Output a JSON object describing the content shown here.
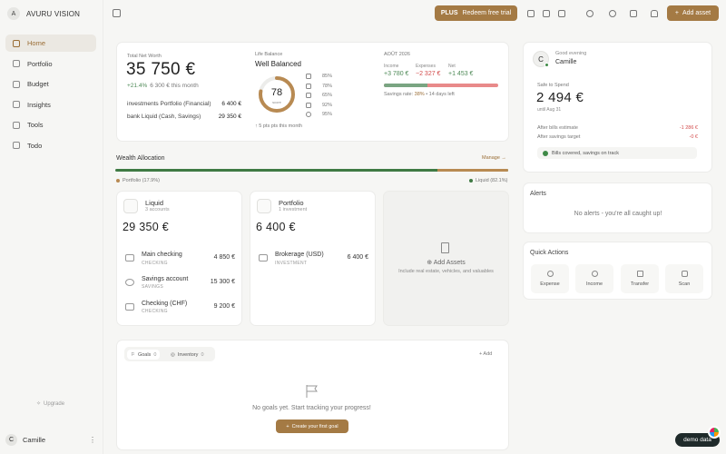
{
  "brand": {
    "avatar_letter": "A",
    "name": "AVURU VISION"
  },
  "nav": [
    {
      "label": "Home",
      "icon": "home-icon",
      "active": true
    },
    {
      "label": "Portfolio",
      "icon": "portfolio-icon"
    },
    {
      "label": "Budget",
      "icon": "budget-icon"
    },
    {
      "label": "Insights",
      "icon": "insights-icon"
    },
    {
      "label": "Tools",
      "icon": "tools-icon"
    },
    {
      "label": "Todo",
      "icon": "todo-icon"
    }
  ],
  "sidebar": {
    "upgrade": "Upgrade",
    "user_letter": "C",
    "user_name": "Camille",
    "menu_glyph": "⋮"
  },
  "topbar": {
    "plus_badge": "PLUS",
    "plus_label": "Redeem free trial",
    "add_asset": "Add asset",
    "add_glyph": "+"
  },
  "net_worth": {
    "label": "Total Net Worth",
    "value": "35 750 €",
    "change_pct": "+21.4%",
    "change_text": "6 300 € this month",
    "rows": [
      {
        "label": "investments  Portfolio (Financial)",
        "value": "6 400 €"
      },
      {
        "label": "bank  Liquid (Cash, Savings)",
        "value": "29 350 €"
      }
    ]
  },
  "life_balance": {
    "label": "Life Balance",
    "title": "Well Balanced",
    "score": 78,
    "score_label": "score",
    "metrics": [
      "85%",
      "78%",
      "65%",
      "92%",
      "95%"
    ],
    "footer": "↑ 5 pts pts this month"
  },
  "month": {
    "label": "AOÛT 2026",
    "income_label": "Income",
    "income": "+3 780 €",
    "expenses_label": "Expenses",
    "expenses": "−2 327 €",
    "net_label": "Net",
    "net": "+1 453 €",
    "savings_rate_fraction": 0.38,
    "savings_label": "Savings rate:",
    "savings_value": "38%",
    "days_left": "• 14 days left",
    "colors": {
      "income": "#4e8a57",
      "expense": "#d24a4a"
    }
  },
  "allocation": {
    "title": "Wealth Allocation",
    "manage": "Manage →",
    "portfolio_fraction": 0.179,
    "portfolio_label": "Portfolio (17.9%)",
    "liquid_label": "Liquid (82.1%)",
    "colors": {
      "portfolio": "#b88a52",
      "liquid": "#3f7a44"
    }
  },
  "liquid": {
    "title": "Liquid",
    "subtitle": "3 accounts",
    "total": "29 350 €",
    "accounts": [
      {
        "name": "Main checking",
        "type": "CHECKING",
        "value": "4 850 €"
      },
      {
        "name": "Savings account",
        "type": "SAVINGS",
        "value": "15 300 €"
      },
      {
        "name": "Checking (CHF)",
        "type": "CHECKING",
        "value": "9 200 €"
      }
    ]
  },
  "portfolio": {
    "title": "Portfolio",
    "subtitle": "1 investment",
    "total": "6 400 €",
    "accounts": [
      {
        "name": "Brokerage (USD)",
        "type": "INVESTMENT",
        "value": "6 400 €"
      }
    ]
  },
  "add_assets": {
    "title": "⊕ Add Assets",
    "subtitle": "Include real estate, vehicles, and valuables"
  },
  "goals": {
    "tab_goals": "Goals",
    "tab_goals_count": "0",
    "tab_inventory": "Inventory",
    "tab_inventory_count": "0",
    "add": "+ Add",
    "empty": "No goals yet. Start tracking your progress!",
    "cta": "Create your first goal",
    "cta_glyph": "+"
  },
  "greeting": {
    "avatar_letter": "C",
    "text": "Good evening",
    "name": "Camille"
  },
  "safe_to_spend": {
    "label": "Safe to Spend",
    "value": "2 494 €",
    "until": "until Aug 31",
    "rows": [
      {
        "label": "After bills estimate",
        "value": "-1 286 €"
      },
      {
        "label": "After savings target",
        "value": "-0 €"
      }
    ],
    "status": "Bills covered, savings on track"
  },
  "alerts": {
    "title": "Alerts",
    "empty": "No alerts - you're all caught up!"
  },
  "quick_actions": {
    "title": "Quick Actions",
    "items": [
      {
        "label": "Expense",
        "icon": "minus-circle-icon"
      },
      {
        "label": "Income",
        "icon": "plus-circle-icon"
      },
      {
        "label": "Transfer",
        "icon": "transfer-icon"
      },
      {
        "label": "Scan",
        "icon": "camera-icon"
      }
    ]
  },
  "demo": {
    "label": "demo data"
  }
}
